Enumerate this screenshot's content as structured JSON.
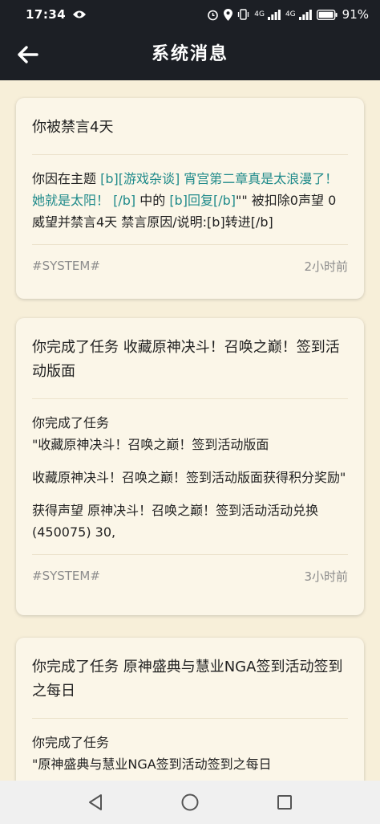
{
  "status_bar": {
    "time": "17:34",
    "signal1": "4G",
    "signal2": "4G",
    "battery": "91%"
  },
  "app_bar": {
    "title": "系统消息"
  },
  "messages": [
    {
      "title": "你被禁言4天",
      "body": [
        {
          "segments": [
            {
              "text": "你因在主题 ",
              "link": false
            },
            {
              "text": "[b][游戏杂谈] 宵宫第二章真是太浪漫了！她就是太阳！ [/b]",
              "link": true
            },
            {
              "text": " 中的 ",
              "link": false
            },
            {
              "text": "[b]回复[/b]",
              "link": true
            },
            {
              "text": "\"\" 被扣除0声望 0威望并禁言4天 禁言原因/说明:[b]转进[/b]",
              "link": false
            }
          ]
        }
      ],
      "tag": "#SYSTEM#",
      "time": "2小时前"
    },
    {
      "title": "你完成了任务 收藏原神决斗！召唤之巅！签到活动版面",
      "body": [
        {
          "segments": [
            {
              "text": "你完成了任务\n\"收藏原神决斗！召唤之巅！签到活动版面",
              "link": false
            }
          ]
        },
        {
          "segments": [
            {
              "text": "收藏原神决斗！召唤之巅！签到活动版面获得积分奖励\"",
              "link": false
            }
          ]
        },
        {
          "segments": [
            {
              "text": "获得声望 原神决斗！召唤之巅！签到活动活动兑换(450075) 30,",
              "link": false
            }
          ]
        }
      ],
      "tag": "#SYSTEM#",
      "time": "3小时前"
    },
    {
      "title": "你完成了任务 原神盛典与慧业NGA签到活动签到之每日",
      "body": [
        {
          "segments": [
            {
              "text": "你完成了任务\n\"原神盛典与慧业NGA签到活动签到之每日",
              "link": false
            }
          ]
        }
      ],
      "tag": "",
      "time": ""
    }
  ],
  "colors": {
    "background": "#f7efd9",
    "card": "#fbf6e8",
    "header": "#1c1f25",
    "link": "#1f8a8a",
    "meta": "#8c8c8c"
  }
}
